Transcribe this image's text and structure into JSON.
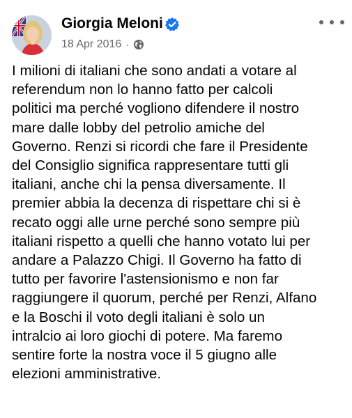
{
  "post": {
    "author": "Giorgia Meloni",
    "verified_icon": "verified-badge-icon",
    "date": "18 Apr 2016",
    "separator": "·",
    "audience_icon": "globe-icon",
    "more_icon": "more-options-icon",
    "text": "I milioni di italiani che sono andati a votare al\nreferendum non lo hanno fatto per calcoli\npolitici ma perché vogliono difendere il nostro\nmare dalle lobby del petrolio amiche del\nGoverno. Renzi si ricordi che fare il Presidente\ndel Consiglio significa rappresentare tutti gli\nitaliani, anche chi la pensa diversamente. Il\npremier abbia la decenza di rispettare chi si è\nrecato oggi alle urne perché sono sempre più\nitaliani rispetto a quelli che hanno votato lui per\nandare a Palazzo Chigi. Il Governo ha fatto di\ntutto per favorire l'astensionismo e non far\nraggiungere il quorum, perché per Renzi, Alfano\ne la Boschi il voto degli italiani è solo un\nintralcio ai loro giochi di potere. Ma faremo\nsentire forte la nostra voce il 5 giugno alle\nelezioni amministrative."
  },
  "colors": {
    "verified_blue": "#1877f2",
    "meta_gray": "#65676b",
    "text": "#050505"
  }
}
